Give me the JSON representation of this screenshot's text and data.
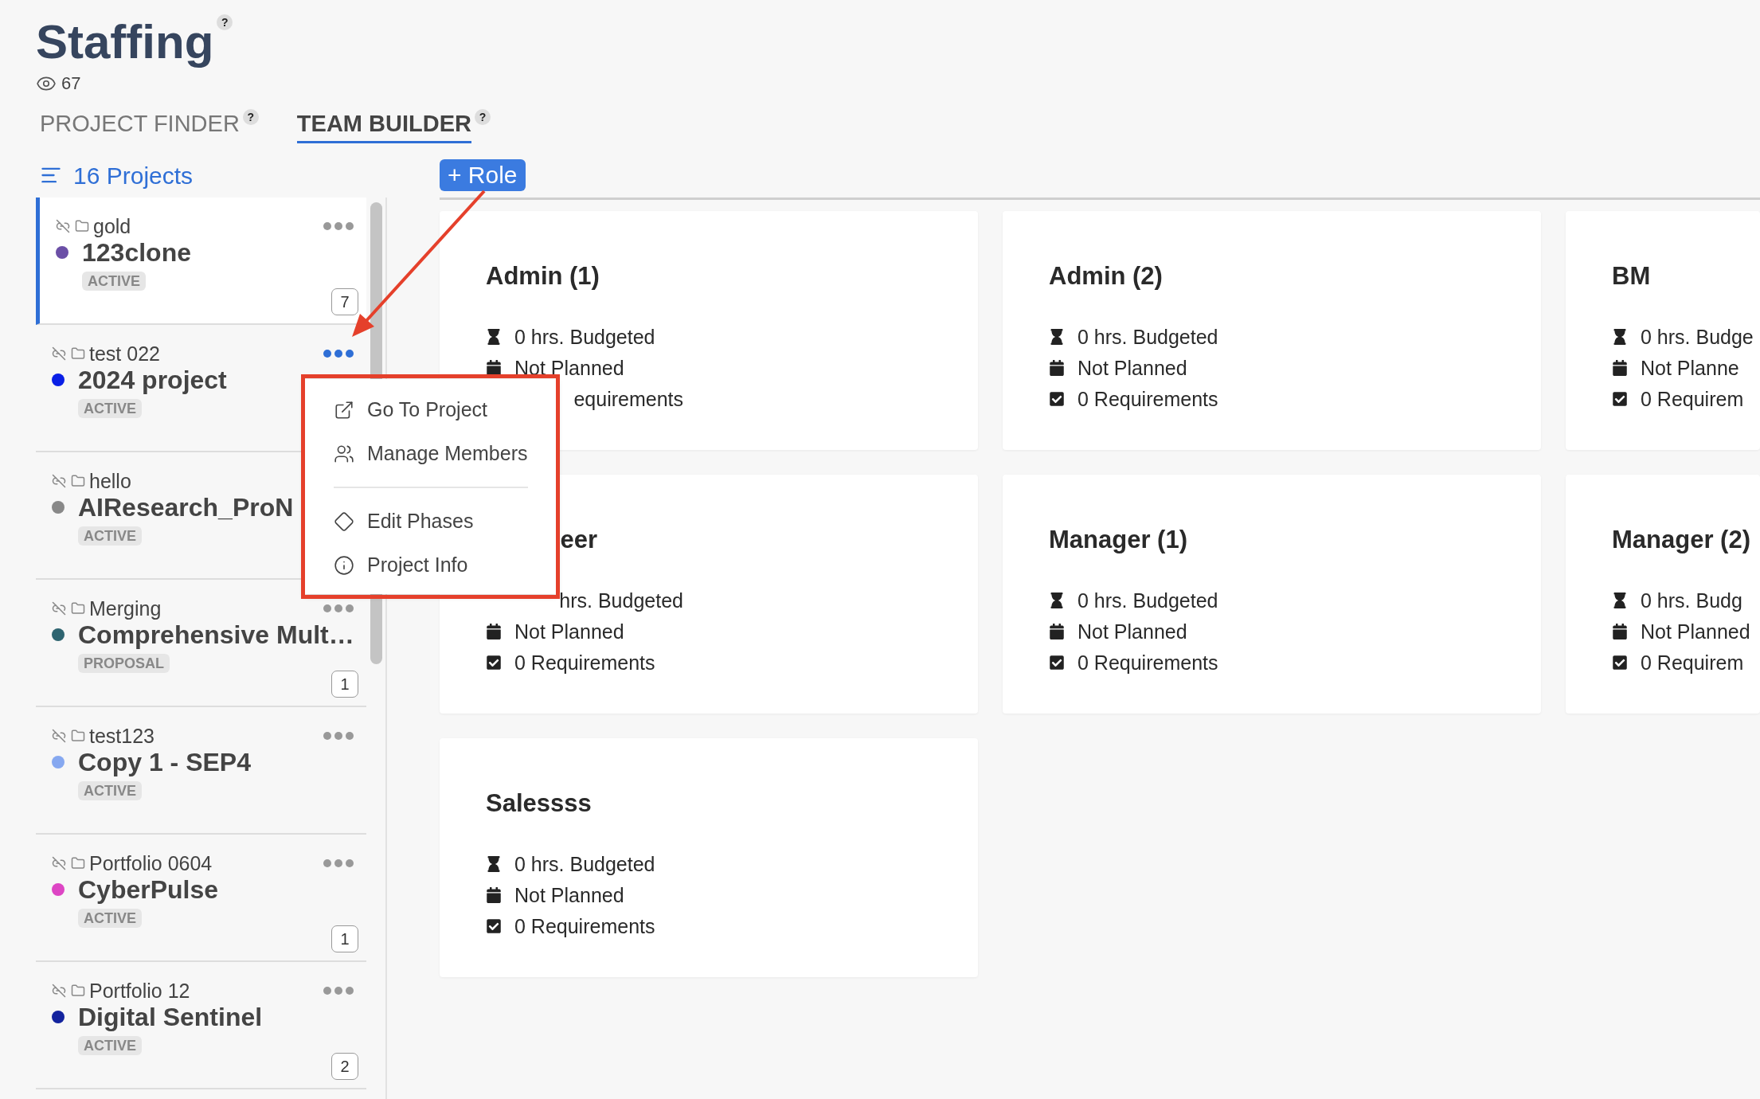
{
  "header": {
    "title": "Staffing",
    "title_help": "?",
    "views": "67"
  },
  "tabs": [
    {
      "label": "PROJECT FINDER",
      "help": "?",
      "selected": false
    },
    {
      "label": "TEAM BUILDER",
      "help": "?",
      "selected": true
    }
  ],
  "sidebar": {
    "count_label": "16 Projects",
    "items": [
      {
        "portfolio": "gold",
        "name": "123clone",
        "color": "#6b4fa6",
        "status": "ACTIVE",
        "count": "7",
        "selected": true,
        "menu_open": false
      },
      {
        "portfolio": "test 022",
        "name": "2024 project",
        "color": "#0a1fe6",
        "status": "ACTIVE",
        "selected": false,
        "menu_open": true
      },
      {
        "portfolio": "hello",
        "name": "AIResearch_ProN",
        "color": "#888888",
        "status": "ACTIVE",
        "selected": false
      },
      {
        "portfolio": "Merging",
        "name": "Comprehensive Mult…",
        "color": "#2e6470",
        "status": "PROPOSAL",
        "count": "1",
        "selected": false,
        "menu_open": false
      },
      {
        "portfolio": "test123",
        "name": "Copy 1 - SEP4",
        "color": "#86a8f0",
        "status": "ACTIVE",
        "selected": false,
        "menu_open": false
      },
      {
        "portfolio": "Portfolio 0604",
        "name": "CyberPulse",
        "color": "#dd45c4",
        "status": "ACTIVE",
        "count": "1",
        "selected": false,
        "menu_open": false
      },
      {
        "portfolio": "Portfolio 12",
        "name": "Digital Sentinel",
        "color": "#13239e",
        "status": "ACTIVE",
        "count": "2",
        "selected": false,
        "menu_open": false
      }
    ]
  },
  "add_role_button": "+ Role",
  "roles": [
    {
      "title": "Admin (1)",
      "stats": [
        {
          "kind": "budget",
          "text": "0 hrs. Budgeted"
        },
        {
          "kind": "plan",
          "text": "Not Planned"
        },
        {
          "kind": "requirements",
          "text": "equirements",
          "covered": true
        }
      ]
    },
    {
      "title": "Admin (2)",
      "stats": [
        {
          "kind": "budget",
          "text": "0 hrs. Budgeted"
        },
        {
          "kind": "plan",
          "text": "Not Planned"
        },
        {
          "kind": "requirements",
          "text": "0 Requirements"
        }
      ]
    },
    {
      "title": "BM",
      "stats": [
        {
          "kind": "budget",
          "text": "0 hrs. Budge"
        },
        {
          "kind": "plan",
          "text": "Not Planne"
        },
        {
          "kind": "requirements",
          "text": "0 Requirem"
        }
      ]
    },
    {
      "title": "eer",
      "title_covered": true,
      "stats": [
        {
          "kind": "budget",
          "text": "hrs. Budgeted",
          "covered": true
        },
        {
          "kind": "plan",
          "text": "Not Planned"
        },
        {
          "kind": "requirements",
          "text": "0 Requirements"
        }
      ]
    },
    {
      "title": "Manager (1)",
      "stats": [
        {
          "kind": "budget",
          "text": "0 hrs. Budgeted"
        },
        {
          "kind": "plan",
          "text": "Not Planned"
        },
        {
          "kind": "requirements",
          "text": "0 Requirements"
        }
      ]
    },
    {
      "title": "Manager (2)",
      "stats": [
        {
          "kind": "budget",
          "text": "0 hrs. Budg"
        },
        {
          "kind": "plan",
          "text": "Not Planned"
        },
        {
          "kind": "requirements",
          "text": "0 Requirem"
        }
      ]
    },
    {
      "title": "Salessss",
      "stats": [
        {
          "kind": "budget",
          "text": "0 hrs. Budgeted"
        },
        {
          "kind": "plan",
          "text": "Not Planned"
        },
        {
          "kind": "requirements",
          "text": "0 Requirements"
        }
      ]
    }
  ],
  "project_menu": {
    "items": [
      {
        "kind": "link",
        "label": "Go To Project"
      },
      {
        "kind": "members",
        "label": "Manage Members"
      },
      {
        "kind": "divider"
      },
      {
        "kind": "phases",
        "label": "Edit Phases"
      },
      {
        "kind": "info",
        "label": "Project Info"
      }
    ]
  }
}
